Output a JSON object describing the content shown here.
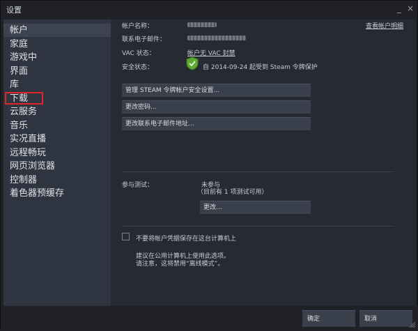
{
  "window": {
    "title": "设置",
    "minimize_label": "_",
    "close_label": "×"
  },
  "sidebar": {
    "items": [
      {
        "label": "帐户"
      },
      {
        "label": "家庭"
      },
      {
        "label": "游戏中"
      },
      {
        "label": "界面"
      },
      {
        "label": "库"
      },
      {
        "label": "下载"
      },
      {
        "label": "云服务"
      },
      {
        "label": "音乐"
      },
      {
        "label": "实况直播"
      },
      {
        "label": "远程畅玩"
      },
      {
        "label": "网页浏览器"
      },
      {
        "label": "控制器"
      },
      {
        "label": "着色器预缓存"
      }
    ],
    "active_index": 0,
    "highlighted_index": 5
  },
  "account": {
    "name_label": "帐户名称：",
    "email_label": "联系电子邮件：",
    "vac_label": "VAC 状态：",
    "vac_value": "帐户无 VAC 封禁",
    "security_label": "安全状态：",
    "security_value": "自 2014-09-24 起受到 Steam 令牌保护",
    "view_details": "查看帐户明细"
  },
  "buttons": {
    "manage_guard": "管理 STEAM 令牌帐户安全设置...",
    "change_password": "更改密码...",
    "change_email": "更改联系电子邮件地址...",
    "beta_change": "更改..."
  },
  "beta": {
    "label": "参与测试：",
    "status": "未参与",
    "note": "（目前有 1 项测试可用）"
  },
  "credentials": {
    "checkbox_label": "不要将帐户凭据保存在这台计算机上",
    "hint_line1": "建议在公用计算机上使用此选项。",
    "hint_line2": "请注意，这将禁用“离线模式”。"
  },
  "footer": {
    "ok_label": "确定",
    "cancel_label": "取消"
  },
  "colors": {
    "shield": "#5fa833",
    "highlight_box": "#e0262b",
    "sidebar_active": "#3d4450"
  }
}
